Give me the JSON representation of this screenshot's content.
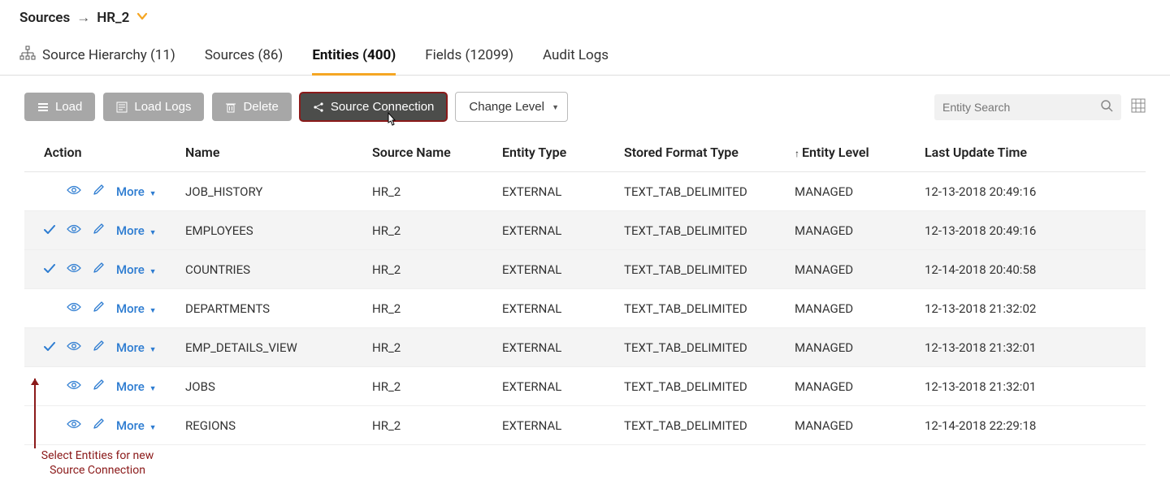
{
  "breadcrumb": {
    "root": "Sources",
    "current": "HR_2"
  },
  "tabs": {
    "hierarchy": "Source Hierarchy (11)",
    "sources": "Sources (86)",
    "entities": "Entities (400)",
    "fields": "Fields (12099)",
    "audit": "Audit Logs"
  },
  "toolbar": {
    "load": "Load",
    "loadlogs": "Load Logs",
    "delete": "Delete",
    "sourceconn": "Source Connection",
    "changelevel": "Change Level",
    "search_placeholder": "Entity Search"
  },
  "columns": {
    "action": "Action",
    "name": "Name",
    "source": "Source Name",
    "type": "Entity Type",
    "format": "Stored Format Type",
    "level": "Entity Level",
    "updated": "Last Update Time"
  },
  "more_label": "More",
  "rows": [
    {
      "selected": false,
      "name": "JOB_HISTORY",
      "source": "HR_2",
      "type": "EXTERNAL",
      "format": "TEXT_TAB_DELIMITED",
      "level": "MANAGED",
      "updated": "12-13-2018 20:49:16"
    },
    {
      "selected": true,
      "name": "EMPLOYEES",
      "source": "HR_2",
      "type": "EXTERNAL",
      "format": "TEXT_TAB_DELIMITED",
      "level": "MANAGED",
      "updated": "12-13-2018 20:49:16"
    },
    {
      "selected": true,
      "name": "COUNTRIES",
      "source": "HR_2",
      "type": "EXTERNAL",
      "format": "TEXT_TAB_DELIMITED",
      "level": "MANAGED",
      "updated": "12-14-2018 20:40:58"
    },
    {
      "selected": false,
      "name": "DEPARTMENTS",
      "source": "HR_2",
      "type": "EXTERNAL",
      "format": "TEXT_TAB_DELIMITED",
      "level": "MANAGED",
      "updated": "12-13-2018 21:32:02"
    },
    {
      "selected": true,
      "name": "EMP_DETAILS_VIEW",
      "source": "HR_2",
      "type": "EXTERNAL",
      "format": "TEXT_TAB_DELIMITED",
      "level": "MANAGED",
      "updated": "12-13-2018 21:32:01"
    },
    {
      "selected": false,
      "name": "JOBS",
      "source": "HR_2",
      "type": "EXTERNAL",
      "format": "TEXT_TAB_DELIMITED",
      "level": "MANAGED",
      "updated": "12-13-2018 21:32:01"
    },
    {
      "selected": false,
      "name": "REGIONS",
      "source": "HR_2",
      "type": "EXTERNAL",
      "format": "TEXT_TAB_DELIMITED",
      "level": "MANAGED",
      "updated": "12-14-2018 22:29:18"
    }
  ],
  "annotation": {
    "line1": "Select Entities for new",
    "line2": "Source Connection"
  }
}
